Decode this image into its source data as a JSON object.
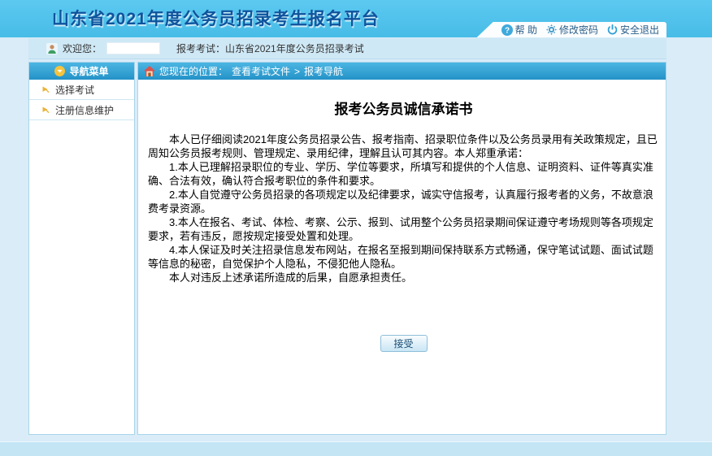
{
  "header": {
    "title": "山东省2021年度公务员招录考生报名平台",
    "links": {
      "help": "帮 助",
      "change_password": "修改密码",
      "logout": "安全退出"
    }
  },
  "welcome_bar": {
    "greeting_label": "欢迎您：",
    "username": "",
    "exam_label": "报考考试：山东省2021年度公务员招录考试"
  },
  "sidebar": {
    "header": "导航菜单",
    "items": [
      {
        "label": "选择考试"
      },
      {
        "label": "注册信息维护"
      }
    ]
  },
  "breadcrumb": {
    "prefix": "您现在的位置：",
    "items": [
      "查看考试文件",
      "报考导航"
    ],
    "separator": ">"
  },
  "document": {
    "title": "报考公务员诚信承诺书",
    "paragraphs": [
      "本人已仔细阅读2021年度公务员招录公告、报考指南、招录职位条件以及公务员录用有关政策规定，且已周知公务员报考规则、管理规定、录用纪律，理解且认可其内容。本人郑重承诺：",
      "1.本人已理解招录职位的专业、学历、学位等要求，所填写和提供的个人信息、证明资料、证件等真实准确、合法有效，确认符合报考职位的条件和要求。",
      "2.本人自觉遵守公务员招录的各项规定以及纪律要求，诚实守信报考，认真履行报考者的义务，不故意浪费考录资源。",
      "3.本人在报名、考试、体检、考察、公示、报到、试用整个公务员招录期间保证遵守考场规则等各项规定要求，若有违反，愿按规定接受处置和处理。",
      "4.本人保证及时关注招录信息发布网站，在报名至报到期间保持联系方式畅通，保守笔试试题、面试试题等信息的秘密，自觉保护个人隐私，不侵犯他人隐私。",
      "本人对违反上述承诺所造成的后果，自愿承担责任。"
    ],
    "accept_button": "接受"
  },
  "colors": {
    "header_bg": "#4fc1e9",
    "bar_bg": "#2d9fd4",
    "page_bg": "#d9ecf8",
    "title_text": "#0f539d",
    "footer_bg": "#c3e5f4"
  }
}
